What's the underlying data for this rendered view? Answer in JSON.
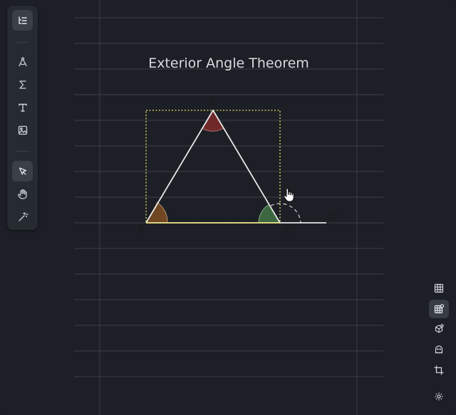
{
  "canvas": {
    "title": "Exterior Angle Theorem",
    "points": {
      "a": "A",
      "b": "B",
      "c": "C",
      "d": "D"
    }
  },
  "colors": {
    "background": "#1c1f25",
    "ruled_line": "#3b4048",
    "triangle": "#e6e6e6",
    "selection": "#e8df6a",
    "angle_a": "#7a4a24",
    "angle_b": "#7a2a2a",
    "angle_c": "#3f6b42"
  },
  "toolbar_left": {
    "items": [
      {
        "name": "outline-icon",
        "active": true
      },
      {
        "name": "geometry-icon",
        "active": false
      },
      {
        "name": "sigma-icon",
        "active": false
      },
      {
        "name": "text-icon",
        "active": false
      },
      {
        "name": "image-icon",
        "active": false
      },
      {
        "name": "select-pointer-icon",
        "active": true
      },
      {
        "name": "hand-icon",
        "active": false
      },
      {
        "name": "magic-wand-icon",
        "active": false
      }
    ]
  },
  "toolbar_right": {
    "items": [
      {
        "name": "grid-icon",
        "active": false
      },
      {
        "name": "grid-settings-icon",
        "active": true
      },
      {
        "name": "cube-icon",
        "active": false
      },
      {
        "name": "ghost-icon",
        "active": false
      },
      {
        "name": "crop-icon",
        "active": false
      },
      {
        "name": "settings-icon",
        "active": false
      }
    ]
  }
}
